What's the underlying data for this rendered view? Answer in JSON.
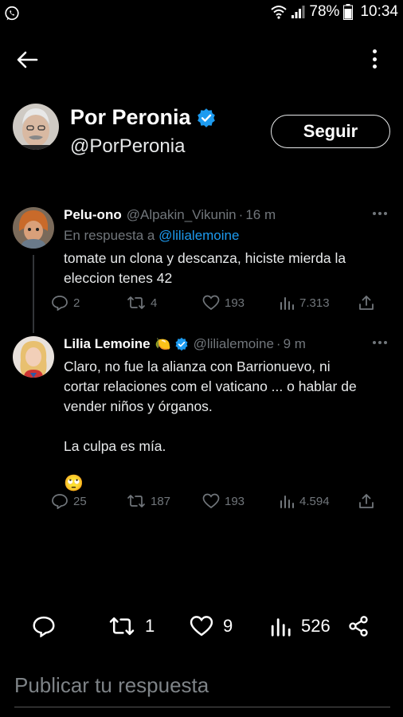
{
  "status_bar": {
    "battery": "78%",
    "time": "10:34"
  },
  "profile": {
    "name": "Por Peronia",
    "handle": "@PorPeronia",
    "follow_label": "Seguir"
  },
  "tweets": [
    {
      "name": "Pelu-ono",
      "handle": "@Alpakin_Vikunin",
      "time": "16 m",
      "reply_prefix": "En respuesta a",
      "reply_to": "@lilialemoine",
      "text": "tomate un clona y descanza, hiciste mierda la\neleccion tenes 42",
      "replies": "2",
      "retweets": "4",
      "likes": "193",
      "views": "7.313"
    },
    {
      "name": "Lilia Lemoine",
      "emoji": "🍋",
      "handle": "@lilialemoine",
      "time": "9 m",
      "text": "Claro, no fue la alianza con Barrionuevo, ni\ncortar relaciones com el vaticano ... o hablar de\nvender niños y órganos.\n\nLa culpa es mía.",
      "emoji_line": "🙄",
      "replies": "25",
      "retweets": "187",
      "likes": "193",
      "views": "4.594"
    }
  ],
  "main_actions": {
    "retweets": "1",
    "likes": "9",
    "views": "526"
  },
  "composer": {
    "placeholder": "Publicar tu respuesta"
  }
}
